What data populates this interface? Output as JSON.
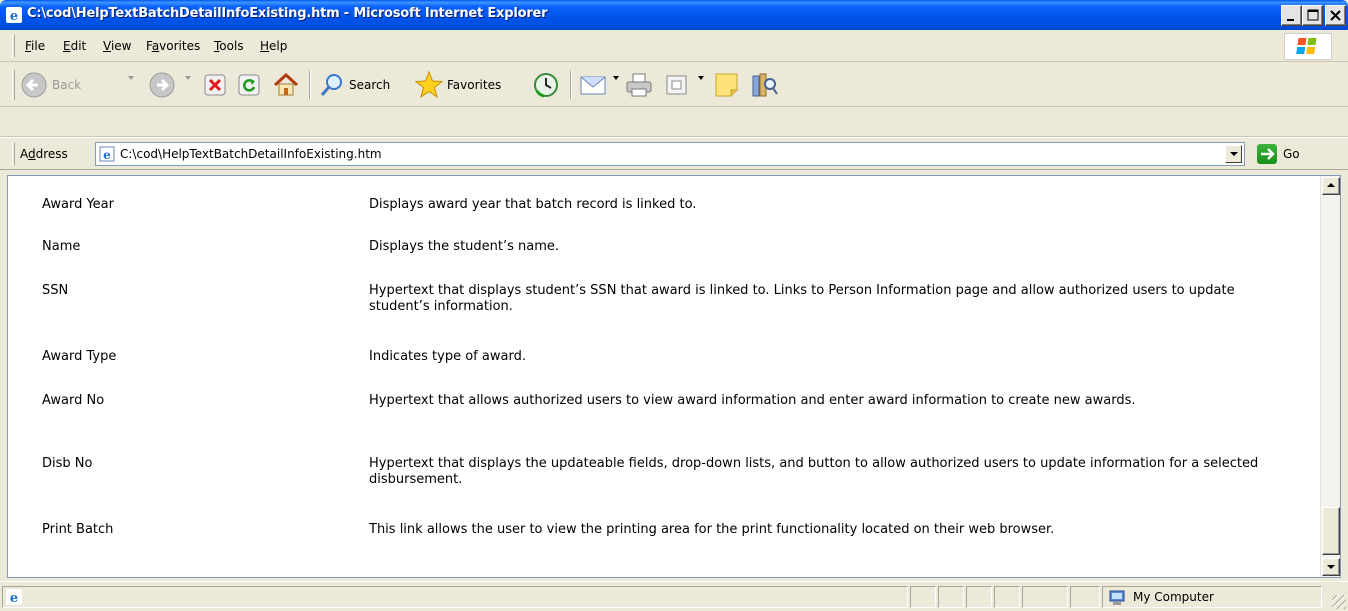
{
  "window": {
    "title": "C:\\cod\\HelpTextBatchDetailInfoExisting.htm - Microsoft Internet Explorer"
  },
  "menu": {
    "items": [
      {
        "key": "F",
        "rest": "ile"
      },
      {
        "key": "E",
        "rest": "dit"
      },
      {
        "key": "V",
        "rest": "iew"
      },
      {
        "pre": "F",
        "key": "a",
        "rest": "vorites"
      },
      {
        "key": "T",
        "rest": "ools"
      },
      {
        "key": "H",
        "rest": "elp"
      }
    ]
  },
  "toolbar": {
    "back_label": "Back",
    "search_label": "Search",
    "favorites_label": "Favorites"
  },
  "address": {
    "label_pre": "A",
    "label_key": "d",
    "label_rest": "dress",
    "url": "C:\\cod\\HelpTextBatchDetailInfoExisting.htm",
    "go_label": "Go"
  },
  "content": {
    "rows": [
      {
        "term": "Award Year",
        "desc": "Displays award year that batch record is linked to."
      },
      {
        "term": "Name",
        "desc": "Displays the student’s name."
      },
      {
        "term": "SSN",
        "desc": "Hypertext that displays student’s SSN that award is linked to. Links to Person Information page and allow authorized users to update student’s information."
      },
      {
        "term": "Award Type",
        "desc": "Indicates type of award."
      },
      {
        "term": "Award No",
        "desc": "Hypertext that allows authorized users to view award information and enter award information to create new awards."
      },
      {
        "term": "Disb No",
        "desc": "Hypertext that displays the updateable fields, drop-down lists, and button to allow authorized users to update information for a selected disbursement."
      },
      {
        "term": "Print Batch",
        "desc": "This link allows the user to view the printing area for the print functionality located on their web browser."
      }
    ]
  },
  "statusbar": {
    "zone_label": "My Computer"
  },
  "colors": {
    "titlebar": "#0053e7",
    "chrome": "#ece9d8",
    "content_bg": "#ffffff"
  }
}
